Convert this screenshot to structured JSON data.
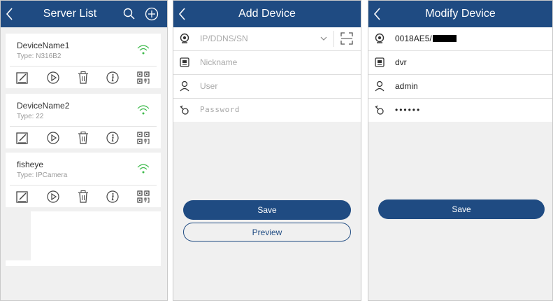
{
  "server_list": {
    "title": "Server List",
    "devices": [
      {
        "name": "DeviceName1",
        "type": "Type: N316B2"
      },
      {
        "name": "DeviceName2",
        "type": "Type: 22"
      },
      {
        "name": "fisheye",
        "type": "Type: IPCamera"
      }
    ]
  },
  "add_device": {
    "title": "Add Device",
    "address_placeholder": "IP/DDNS/SN",
    "nickname_placeholder": "Nickname",
    "user_placeholder": "User",
    "password_placeholder": "Password",
    "save_label": "Save",
    "preview_label": "Preview"
  },
  "modify_device": {
    "title": "Modify Device",
    "serial_value": "0018AE5/",
    "nickname_value": "dvr",
    "user_value": "admin",
    "password_value": "••••••",
    "save_label": "Save"
  },
  "colors": {
    "header": "#1f4b82",
    "wifi": "#3cb94a",
    "background": "#f0f0f0"
  }
}
